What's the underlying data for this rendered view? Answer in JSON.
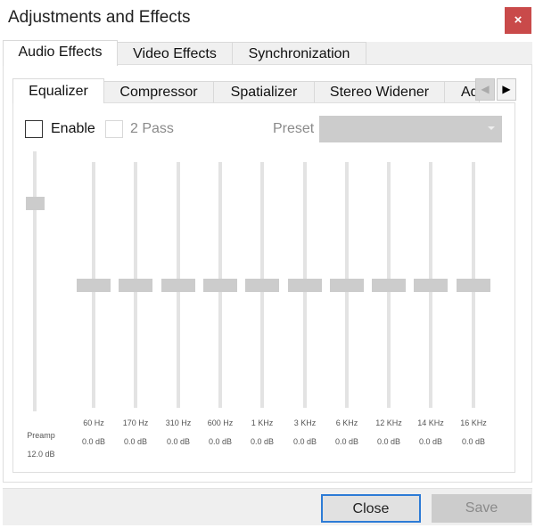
{
  "window": {
    "title": "Adjustments and Effects",
    "close_icon": "×"
  },
  "main_tabs": [
    {
      "label": "Audio Effects",
      "active": true
    },
    {
      "label": "Video Effects",
      "active": false
    },
    {
      "label": "Synchronization",
      "active": false
    }
  ],
  "sub_tabs": [
    {
      "label": "Equalizer",
      "active": true
    },
    {
      "label": "Compressor",
      "active": false
    },
    {
      "label": "Spatializer",
      "active": false
    },
    {
      "label": "Stereo Widener",
      "active": false
    },
    {
      "label": "Advanced",
      "active": false
    }
  ],
  "tab_scroll": {
    "left_icon": "◀",
    "right_icon": "▶"
  },
  "equalizer": {
    "enable": {
      "label": "Enable",
      "checked": false
    },
    "two_pass": {
      "label": "2 Pass",
      "checked": false,
      "disabled": true
    },
    "preset": {
      "label": "Preset",
      "value": "",
      "disabled": true
    },
    "preamp": {
      "label": "Preamp",
      "value": "12.0 dB",
      "level_fraction": 0.8
    },
    "bands": [
      {
        "freq": "60 Hz",
        "value": "0.0 dB",
        "level_fraction": 0.5
      },
      {
        "freq": "170 Hz",
        "value": "0.0 dB",
        "level_fraction": 0.5
      },
      {
        "freq": "310 Hz",
        "value": "0.0 dB",
        "level_fraction": 0.5
      },
      {
        "freq": "600 Hz",
        "value": "0.0 dB",
        "level_fraction": 0.5
      },
      {
        "freq": "1 KHz",
        "value": "0.0 dB",
        "level_fraction": 0.5
      },
      {
        "freq": "3 KHz",
        "value": "0.0 dB",
        "level_fraction": 0.5
      },
      {
        "freq": "6 KHz",
        "value": "0.0 dB",
        "level_fraction": 0.5
      },
      {
        "freq": "12 KHz",
        "value": "0.0 dB",
        "level_fraction": 0.5
      },
      {
        "freq": "14 KHz",
        "value": "0.0 dB",
        "level_fraction": 0.5
      },
      {
        "freq": "16 KHz",
        "value": "0.0 dB",
        "level_fraction": 0.5
      }
    ]
  },
  "buttons": {
    "close": "Close",
    "save": "Save"
  }
}
